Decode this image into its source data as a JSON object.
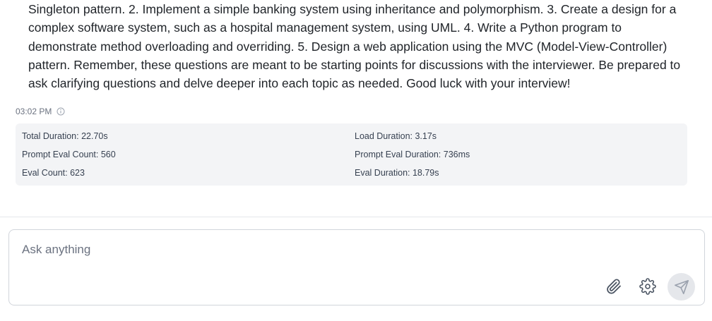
{
  "message": {
    "text": "Singleton pattern. 2. Implement a simple banking system using inheritance and polymorphism. 3. Create a design for a complex software system, such as a hospital management system, using UML. 4. Write a Python program to demonstrate method overloading and overriding. 5. Design a web application using the MVC (Model-View-Controller) pattern. Remember, these questions are meant to be starting points for discussions with the interviewer. Be prepared to ask clarifying questions and delve deeper into each topic as needed. Good luck with your interview!",
    "timestamp": "03:02 PM"
  },
  "stats": {
    "total_duration": "Total Duration: 22.70s",
    "load_duration": "Load Duration: 3.17s",
    "prompt_eval_count": "Prompt Eval Count: 560",
    "prompt_eval_duration": "Prompt Eval Duration: 736ms",
    "eval_count": "Eval Count: 623",
    "eval_duration": "Eval Duration: 18.79s"
  },
  "composer": {
    "placeholder": "Ask anything",
    "value": ""
  },
  "icons": {
    "info": "info-icon",
    "attach": "paperclip-icon",
    "settings": "gear-icon",
    "send": "send-icon"
  },
  "colors": {
    "stats_background": "#f3f4f6",
    "send_button_background": "#e5e7eb",
    "text": "#1f2328",
    "muted": "#6b7280"
  }
}
